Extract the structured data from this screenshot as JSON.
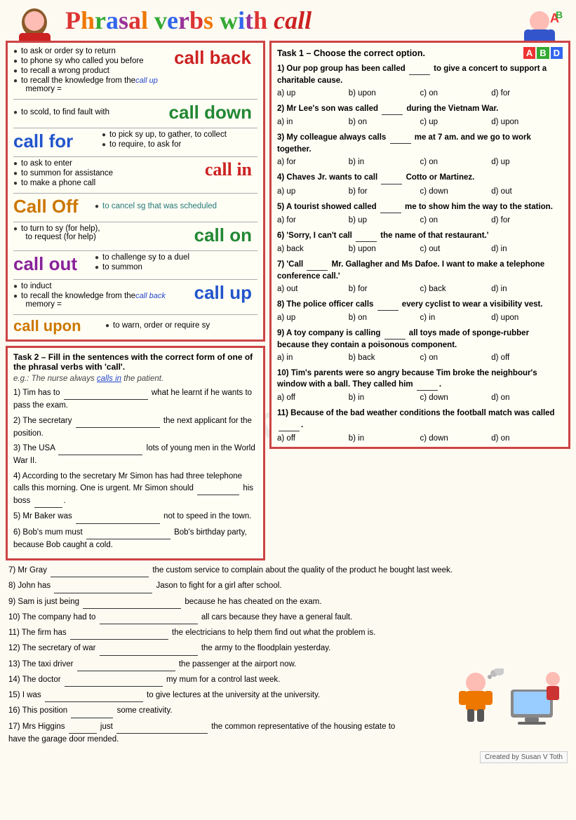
{
  "title": {
    "text": "Phrasal verbs with call",
    "part1": "Phrasal ",
    "part2": "verbs ",
    "part3": "with ",
    "part4": "call"
  },
  "definitions": {
    "call_back": {
      "label": "call back",
      "bullets": [
        "to ask or order sy to return",
        "to phone sy who called you before",
        "to recall a wrong product",
        "to recall the knowledge from the memory = call up"
      ]
    },
    "call_down": {
      "label": "call down",
      "bullet": "to scold, to find fault with"
    },
    "call_for": {
      "label": "call for",
      "bullets": [
        "to pick sy up, to gather, to collect",
        "to require, to ask for"
      ]
    },
    "call_in": {
      "label": "call in",
      "bullets": [
        "to ask to enter",
        "to summon for assistance",
        "to make a phone call"
      ]
    },
    "call_off": {
      "label": "Call Off",
      "bullet": "to cancel sg that was scheduled"
    },
    "call_on": {
      "label": "call on",
      "bullets": [
        "to turn to sy (for help), to request (for help)"
      ]
    },
    "call_out": {
      "label": "call out",
      "bullets": [
        "to challenge sy to a duel",
        "to summon"
      ]
    },
    "call_up": {
      "label": "call up",
      "bullets": [
        "to induct",
        "to recall the knowledge from the memory = call back"
      ]
    },
    "call_upon": {
      "label": "call upon",
      "bullet": "to warn, order or require sy"
    }
  },
  "task2": {
    "title": "Task 2 – Fill in the sentences with the correct form of one of the phrasal verbs with 'call'.",
    "example": "e.g.: The nurse always calls in the patient.",
    "items": [
      "1) Tim has to _________________________ what he learnt if he wants to pass the exam.",
      "2) The secretary _________________________ the next applicant for the position.",
      "3) The USA _________________________ lots of young men in the World War II.",
      "4) According to the secretary Mr Simon has had three telephone calls this morning. One is urgent. Mr Simon should __________ his boss __________.",
      "5) Mr Baker was _________________________ not to speed in the town.",
      "6) Bob's mum must _________________________ Bob's birthday party, because Bob caught a cold.",
      "7) Mr Gray _________________________ the custom service to complain about the quality of the product he bought last week.",
      "8) John has _________________________ Jason to fight for a girl after school.",
      "9) Sam is just being _________________________ because he has cheated on the exam.",
      "10) The company had to _________________________ all cars because they have a general fault.",
      "11) The firm has _________________________ the electricians to help them find out what the problem is.",
      "12) The secretary of war _________________________ the army to the floodplain yesterday.",
      "13) The taxi driver _________________________ the passenger at the airport now.",
      "14) The doctor _________________________ my mum for a control last week.",
      "15) I was _________________________ to give lectures at the university at the university.",
      "16) This position __________ some creativity.",
      "17) Mrs Higgins ______ just _________________________ the common representative of the housing estate to have the garage door mended."
    ]
  },
  "task1": {
    "title": "Task 1 – Choose the correct option.",
    "questions": [
      {
        "num": "1)",
        "text": "Our pop group has been called _____ to give a concert to support a charitable cause.",
        "options": [
          "a) up",
          "b) upon",
          "c) on",
          "d) for"
        ]
      },
      {
        "num": "2)",
        "text": "Mr Lee's son was called _____ during the Vietnam War.",
        "options": [
          "a) in",
          "b) on",
          "c) up",
          "d) upon"
        ]
      },
      {
        "num": "3)",
        "text": "My colleague always calls _____ me at 7 am. and we go to work together.",
        "options": [
          "a) for",
          "b) in",
          "c) on",
          "d) up"
        ]
      },
      {
        "num": "4)",
        "text": "Chaves Jr. wants to call _____ Cotto or Martinez.",
        "options": [
          "a) up",
          "b) for",
          "c) down",
          "d) out"
        ]
      },
      {
        "num": "5)",
        "text": "A tourist showed called _____ me to show him the way to the station.",
        "options": [
          "a) for",
          "b) up",
          "c) on",
          "d) for"
        ]
      },
      {
        "num": "6)",
        "text": "'Sorry, I can't call _____ the name of that restaurant.'",
        "options": [
          "a) back",
          "b) upon",
          "c) out",
          "d) in"
        ]
      },
      {
        "num": "7)",
        "text": "'Call _____ Mr. Gallagher and Ms Dafoe. I want to make a telephone conference call.'",
        "options": [
          "a) out",
          "b) for",
          "c) back",
          "d) in"
        ]
      },
      {
        "num": "8)",
        "text": "The police officer calls _____ every cyclist to wear a visibility vest.",
        "options": [
          "a) up",
          "b) on",
          "c) in",
          "d) upon"
        ]
      },
      {
        "num": "9)",
        "text": "A toy company is calling _____ all toys made of sponge-rubber because they contain a poisonous component.",
        "options": [
          "a) in",
          "b) back",
          "c) on",
          "d) off"
        ]
      },
      {
        "num": "10)",
        "text": "Tim's parents were so angry because Tim broke the neighbour's window with a ball. They called him _____.",
        "options": [
          "a) off",
          "b) in",
          "c) down",
          "d) on"
        ]
      },
      {
        "num": "11)",
        "text": "Because of the bad weather conditions the football match was called _____.",
        "options": [
          "a) off",
          "b) in",
          "c) down",
          "d) on"
        ]
      }
    ]
  },
  "footer": {
    "text": "Created by Susan V Toth"
  }
}
